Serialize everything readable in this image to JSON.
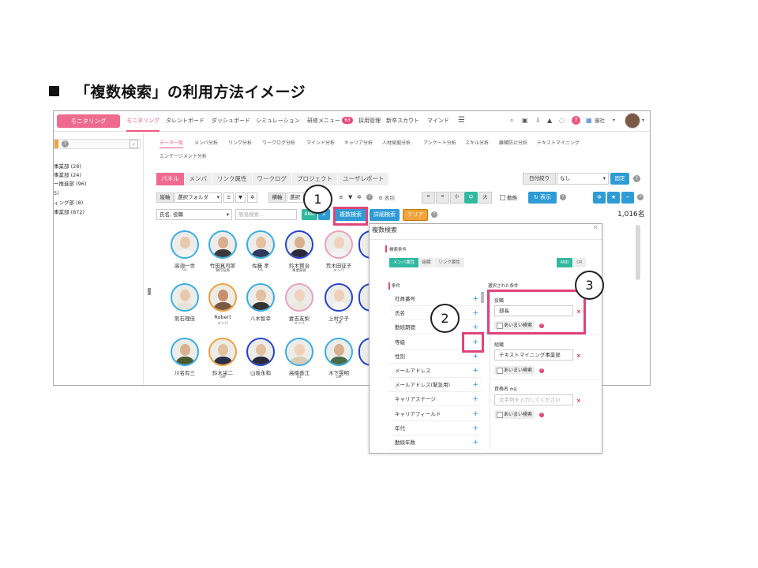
{
  "slide": {
    "title": "「複数検索」の利用方法イメージ"
  },
  "topnav": {
    "brand": "モニタリング",
    "items": [
      "モニタリング",
      "タレントボード",
      "ダッシュボード",
      "シミュレーション",
      "研修メニュー",
      "採用管理",
      "新卒スカウト",
      "マインド"
    ],
    "badge": "63",
    "company": "御社"
  },
  "left": {
    "items": [
      "事業部 (28)",
      "事業部 (24)",
      "ー推進部 (96)",
      "5)",
      "ィング部 (8)",
      "事業部 (872)"
    ]
  },
  "subtabs": [
    "データ一覧",
    "メンバ分析",
    "リンク分析",
    "ワークログ分析",
    "マインド分析",
    "キャリア分析",
    "人材発掘分析",
    "アンケート分析",
    "スキル分析",
    "離職防止分析",
    "テキストマイニング",
    "エンゲージメント分析"
  ],
  "panel_tabs": [
    "パネル",
    "メンバ",
    "リンク属性",
    "ワークログ",
    "プロジェクト",
    "ユーザレポート"
  ],
  "toolbar": {
    "date_label": "日付絞り",
    "date_value": "なし",
    "fix": "固定",
    "sort_label": "縦軸",
    "folder_select": "選択フォルダ",
    "axis_label": "横軸",
    "axis_select": "選択",
    "annotation": "表別",
    "size_small_label": "小",
    "size_mid": "中",
    "size_large": "大",
    "pin": "動態",
    "display": "表示",
    "count": "1,016名"
  },
  "search": {
    "field": "氏名, 役職",
    "placeholder": "簡易検索...",
    "and": "AND",
    "multi": "複数検索",
    "detail": "詳細検索",
    "clear": "クリア"
  },
  "people": [
    {
      "name": "高須一世",
      "role": "GL",
      "ring": "#3aaee0",
      "skin": "#e9c9ae",
      "suit": "#f4f4f4"
    },
    {
      "name": "竹田真司郎",
      "role": "執行役員",
      "ring": "#3aaee0",
      "skin": "#d8b090",
      "suit": "#3a3a3a"
    },
    {
      "name": "佐藤 孝",
      "role": "GL",
      "ring": "#3aaee0",
      "skin": "#e2c0a0",
      "suit": "#2f3a5a"
    },
    {
      "name": "鈴木賢治",
      "role": "事業部長",
      "ring": "#2444c8",
      "skin": "#d8b090",
      "suit": "#2a2a3a"
    },
    {
      "name": "荒木田征子",
      "role": "メンバ",
      "ring": "#e9a0c0",
      "skin": "#f0d2be",
      "suit": "#f3f3f3"
    },
    {
      "name": "熊石理佳",
      "role": "",
      "ring": "#3aaee0",
      "skin": "#e9c9ae",
      "suit": "#e8e3d8"
    },
    {
      "name": "Robert",
      "role": "メンバ",
      "ring": "#f0a040",
      "skin": "#c89070",
      "suit": "#7a5a40"
    },
    {
      "name": "八木智幸",
      "role": "",
      "ring": "#3aaee0",
      "skin": "#e2c0a0",
      "suit": "#333"
    },
    {
      "name": "倉吉友梨",
      "role": "メンバ",
      "ring": "#e9a0c0",
      "skin": "#f0d2be",
      "suit": "#ece8e0"
    },
    {
      "name": "上村夕子",
      "role": "GM",
      "ring": "#2444c8",
      "skin": "#efd0b8",
      "suit": "#f4f4f4"
    },
    {
      "name": "川名有三",
      "role": "",
      "ring": "#3aaee0",
      "skin": "#d8b090",
      "suit": "#4a5a30"
    },
    {
      "name": "鈴木栄二",
      "role": "GM",
      "ring": "#f0a040",
      "skin": "#e2c0a0",
      "suit": "#2a2f4a"
    },
    {
      "name": "山坂永和",
      "role": "",
      "ring": "#2444c8",
      "skin": "#e2c0a0",
      "suit": "#2a2a3a"
    },
    {
      "name": "高楠善江",
      "role": "GL",
      "ring": "#3aaee0",
      "skin": "#efd0b8",
      "suit": "#d8ccb4"
    },
    {
      "name": "木下晃明",
      "role": "GM",
      "ring": "#3aaee0",
      "skin": "#d8b090",
      "suit": "#4a6a4a"
    }
  ],
  "modal": {
    "title": "複数検索",
    "section": "検索条件",
    "tabs": [
      "メンバ属性",
      "組織",
      "リンク属性"
    ],
    "and": "AND",
    "or": "OR",
    "conditions_header": "条件",
    "conditions": [
      "社員番号",
      "氏名",
      "勤続期間",
      "等級",
      "性別",
      "メールアドレス",
      "メールアドレス(緊急用)",
      "キャリアステージ",
      "キャリアフィールド",
      "年代",
      "勤続年数"
    ],
    "selected_header": "選択された条件",
    "selected": [
      {
        "label": "役職",
        "value": "部長",
        "placeholder": ""
      },
      {
        "label": "組織",
        "value": "テキストマイニング事業部",
        "placeholder": ""
      },
      {
        "label": "資格名",
        "sub": "件名",
        "value": "",
        "placeholder": "文字列を入力してください"
      }
    ],
    "fuzzy": "あいまい検索"
  },
  "callouts": [
    "1",
    "2",
    "3"
  ]
}
